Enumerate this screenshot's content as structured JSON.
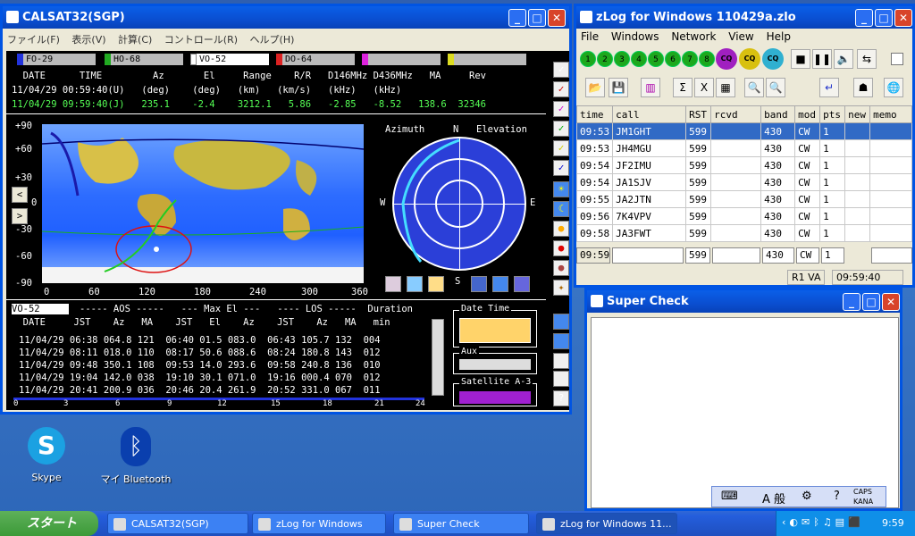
{
  "calsat": {
    "title": "CALSAT32(SGP)",
    "menu": [
      "ファイル(F)",
      "表示(V)",
      "計算(C)",
      "コントロール(R)",
      "ヘルプ(H)"
    ],
    "sats": [
      {
        "name": "FO-29",
        "color": "#2233dd"
      },
      {
        "name": "HO-68",
        "color": "#22aa22"
      },
      {
        "name": "VO-52",
        "color": "#ffffff",
        "selected": true
      },
      {
        "name": "DO-64",
        "color": "#dd2222"
      },
      {
        "name": "",
        "color": "#dd22dd"
      },
      {
        "name": "",
        "color": "#dddd22"
      }
    ],
    "hdr": "  DATE      TIME         Az       El     Range    R/R   D146MHz D436MHz   MA     Rev",
    "hdr2": "11/04/29 00:59:40(U)   (deg)    (deg)   (km)   (km/s)   (kHz)   (kHz)",
    "row": "11/04/29 09:59:40(J)   235.1    -2.4    3212.1   5.86   -2.85   -8.52   138.6  32346",
    "lat": [
      "+90",
      "+60",
      "+30",
      "0",
      "-30",
      "-60",
      "-90"
    ],
    "lon": [
      "0",
      "60",
      "120",
      "180",
      "240",
      "300",
      "360"
    ],
    "polar": {
      "title_az": "Azimuth",
      "n": "N",
      "title_el": "Elevation",
      "w": "W",
      "e": "E",
      "s": "S"
    },
    "pass_sat": "VO-52",
    "pass_hdr1": "----- AOS -----   --- Max El ---   ---- LOS -----  Duration",
    "pass_hdr2": "  DATE     JST    Az   MA    JST   El    Az    JST    Az   MA   min",
    "passes": [
      "11/04/29 06:38 064.8 121  06:40 01.5 083.0  06:43 105.7 132  004",
      "11/04/29 08:11 018.0 110  08:17 50.6 088.6  08:24 180.8 143  012",
      "11/04/29 09:48 350.1 108  09:53 14.0 293.6  09:58 240.8 136  010",
      "11/04/29 19:04 142.0 038  19:10 30.1 071.0  19:16 000.4 070  012",
      "11/04/29 20:41 200.9 036  20:46 20.4 261.9  20:52 331.0 067  011"
    ],
    "hours": [
      "0",
      "3",
      "6",
      "9",
      "12",
      "15",
      "18",
      "21",
      "24"
    ],
    "dt_label": "Date Time",
    "aux_label": "Aux",
    "sat_label": "Satellite  A-3"
  },
  "zlog": {
    "title": "zLog for Windows  110429a.zlo",
    "menu": [
      "File",
      "Windows",
      "Network",
      "View",
      "Help"
    ],
    "nums": [
      "1",
      "2",
      "3",
      "4",
      "5",
      "6",
      "7",
      "8"
    ],
    "cq": [
      "CQ",
      "CQ",
      "CQ"
    ],
    "cols": [
      "time",
      "call",
      "RST",
      "rcvd",
      "band",
      "mod",
      "pts",
      "new",
      "memo"
    ],
    "rows": [
      [
        "09:53",
        "JM1GHT",
        "599",
        "",
        "430",
        "CW",
        "1",
        "",
        ""
      ],
      [
        "09:53",
        "JH4MGU",
        "599",
        "",
        "430",
        "CW",
        "1",
        "",
        ""
      ],
      [
        "09:54",
        "JF2IMU",
        "599",
        "",
        "430",
        "CW",
        "1",
        "",
        ""
      ],
      [
        "09:54",
        "JA1SJV",
        "599",
        "",
        "430",
        "CW",
        "1",
        "",
        ""
      ],
      [
        "09:55",
        "JA2JTN",
        "599",
        "",
        "430",
        "CW",
        "1",
        "",
        ""
      ],
      [
        "09:56",
        "7K4VPV",
        "599",
        "",
        "430",
        "CW",
        "1",
        "",
        ""
      ],
      [
        "09:58",
        "JA3FWT",
        "599",
        "",
        "430",
        "CW",
        "1",
        "",
        ""
      ]
    ],
    "entry": {
      "time": "09:59",
      "call": "",
      "rst": "599",
      "rcvd": "",
      "band": "430",
      "mode": "CW",
      "pts": "1"
    },
    "status_op": "R1 VA",
    "status_time": "09:59:40"
  },
  "superc": {
    "title": "Super Check"
  },
  "desktop": {
    "skype": "Skype",
    "bt": "マイ Bluetooth"
  },
  "taskbar": {
    "start": "スタート",
    "items": [
      "CALSAT32(SGP)",
      "zLog for Windows",
      "Super Check",
      "zLog for Windows  11..."
    ],
    "clock": "9:59"
  },
  "ime": {
    "mode": "A 般",
    "caps": "CAPS",
    "kana": "KANA"
  }
}
